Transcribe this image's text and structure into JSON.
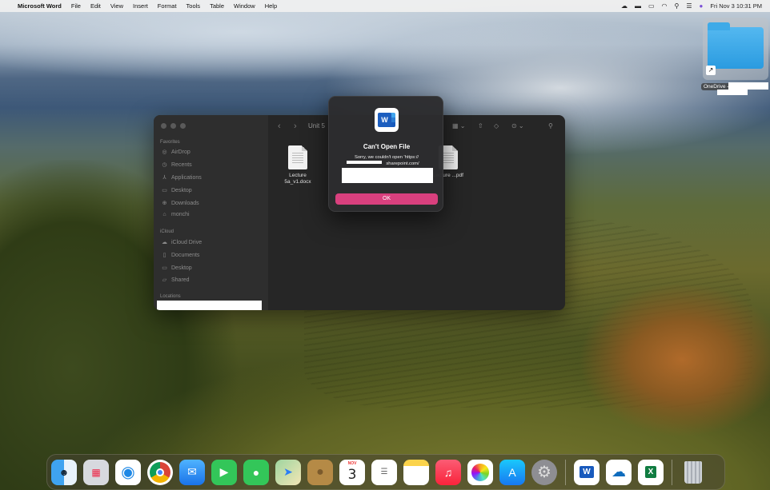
{
  "menubar": {
    "app_name": "Microsoft Word",
    "menus": [
      "File",
      "Edit",
      "View",
      "Insert",
      "Format",
      "Tools",
      "Table",
      "Window",
      "Help"
    ],
    "clock": "Fri Nov 3  10:31 PM"
  },
  "desktop": {
    "onedrive_label": "OneDrive -"
  },
  "finder": {
    "title": "Unit 5",
    "favorites_header": "Favorites",
    "favorites": [
      {
        "label": "AirDrop",
        "icon": "airdrop-icon",
        "glyph": "◎"
      },
      {
        "label": "Recents",
        "icon": "clock-icon",
        "glyph": "◷"
      },
      {
        "label": "Applications",
        "icon": "applications-icon",
        "glyph": "⅄"
      },
      {
        "label": "Desktop",
        "icon": "desktop-icon",
        "glyph": "▭"
      },
      {
        "label": "Downloads",
        "icon": "downloads-icon",
        "glyph": "⊕"
      },
      {
        "label": "monchi",
        "icon": "home-icon",
        "glyph": "⌂"
      }
    ],
    "icloud_header": "iCloud",
    "icloud": [
      {
        "label": "iCloud Drive",
        "icon": "cloud-icon",
        "glyph": "☁"
      },
      {
        "label": "Documents",
        "icon": "document-icon",
        "glyph": "▯"
      },
      {
        "label": "Desktop",
        "icon": "desktop-icon",
        "glyph": "▭"
      },
      {
        "label": "Shared",
        "icon": "shared-folder-icon",
        "glyph": "▱"
      }
    ],
    "locations_header": "Locations",
    "files": [
      {
        "name": "Lecture 5a_v1.docx"
      },
      {
        "name": "Lecture ...pdf"
      }
    ]
  },
  "dialog": {
    "title": "Can't Open File",
    "message_line1": "Sorry, we couldn't open 'https://",
    "message_line2": "sharepoint.com/",
    "ok_label": "OK"
  },
  "dock": {
    "calendar_month": "NOV",
    "calendar_day": "3",
    "apps": [
      "Finder",
      "Launchpad",
      "Safari",
      "Chrome",
      "Mail",
      "FaceTime",
      "Messages",
      "Maps",
      "Contacts",
      "Calendar",
      "Reminders",
      "Notes",
      "Music",
      "Photos",
      "App Store",
      "System Settings",
      "Microsoft Word",
      "OneDrive",
      "Microsoft Excel",
      "Trash"
    ]
  }
}
